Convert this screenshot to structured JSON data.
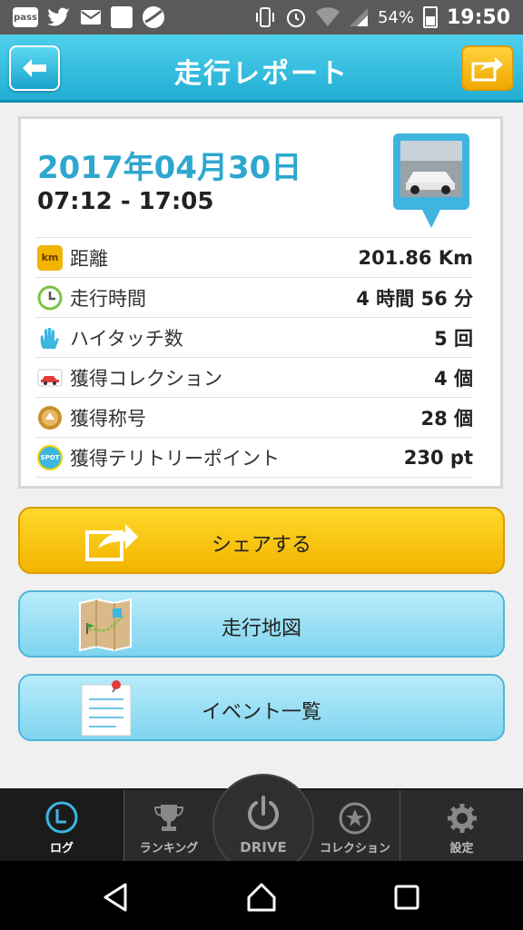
{
  "status_bar": {
    "left_icons": [
      {
        "icon": "pass-app-icon",
        "label": "pass"
      },
      {
        "icon": "twitter-icon"
      },
      {
        "icon": "mail-icon"
      },
      {
        "icon": "app-square-icon"
      },
      {
        "icon": "globe-app-icon"
      }
    ],
    "battery": "54%",
    "time": "19:50"
  },
  "header": {
    "title": "走行レポート",
    "back_icon": "back-arrow-icon",
    "share_icon": "share-icon"
  },
  "report": {
    "date": "2017年04月30日",
    "time_range": "07:12 - 17:05",
    "rows": [
      {
        "icon": "km-icon",
        "icon_text": "km",
        "label": "距離",
        "value": "201.86 Km",
        "color": "#f2b400"
      },
      {
        "icon": "clock-icon",
        "label": "走行時間",
        "value": "4 時間 56 分",
        "color": "#7cc242"
      },
      {
        "icon": "hand-icon",
        "label": "ハイタッチ数",
        "value": "5 回",
        "color": "#3db6e0"
      },
      {
        "icon": "car-icon",
        "label": "獲得コレクション",
        "value": "4 個",
        "color": "#e23b3b"
      },
      {
        "icon": "medal-icon",
        "label": "獲得称号",
        "value": "28 個",
        "color": "#c8902a"
      },
      {
        "icon": "spot-icon",
        "icon_text": "SPOT",
        "label": "獲得テリトリーポイント",
        "value": "230 pt",
        "color": "#3db6e0"
      }
    ]
  },
  "actions": {
    "share": "シェアする",
    "map": "走行地図",
    "events": "イベント一覧"
  },
  "tabs": [
    {
      "label": "ログ",
      "icon": "log-icon",
      "active": true
    },
    {
      "label": "ランキング",
      "icon": "trophy-icon",
      "active": false
    },
    {
      "label": "DRIVE",
      "icon": "power-icon",
      "active": false
    },
    {
      "label": "コレクション",
      "icon": "star-icon",
      "active": false
    },
    {
      "label": "設定",
      "icon": "gear-icon",
      "active": false
    }
  ],
  "accent_color": "#2ea7cf"
}
